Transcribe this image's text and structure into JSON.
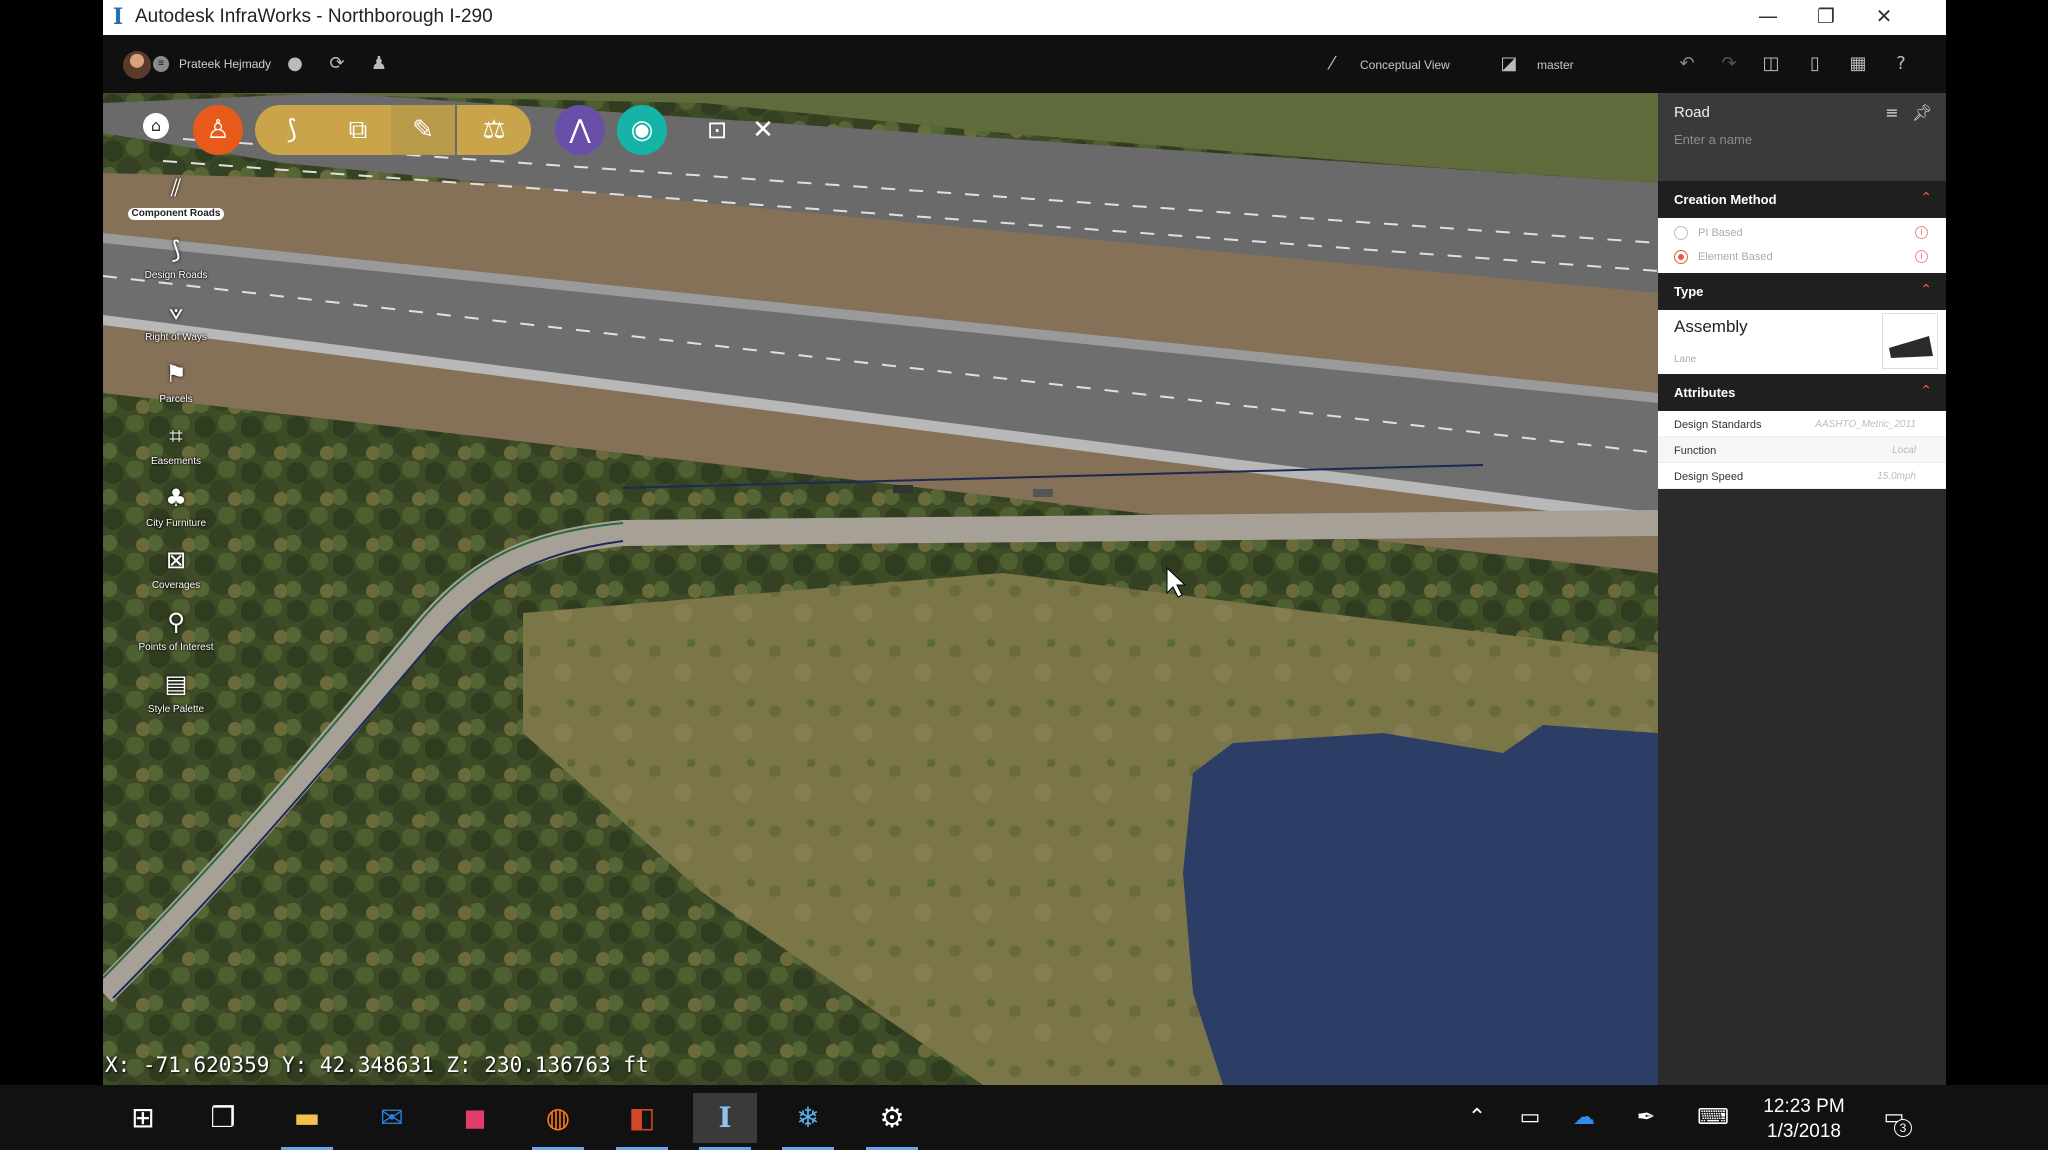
{
  "window": {
    "title": "Autodesk InfraWorks - Northborough I-290",
    "app_icon": "I",
    "controls": [
      "—",
      "❐",
      "✕"
    ]
  },
  "appbar": {
    "user_name": "Prateek Hejmady",
    "view_label": "Conceptual View",
    "branch_label": "master"
  },
  "toolbar": {
    "icons": [
      "home-icon",
      "person-icon",
      "roads-icon",
      "copy-icon",
      "pencil-icon",
      "scale-icon",
      "analyze-icon",
      "target-icon",
      "presentation-icon",
      "tools-icon"
    ]
  },
  "sidebar": {
    "items": [
      {
        "label": "Component Roads",
        "icon": "component-roads-icon",
        "active": true
      },
      {
        "label": "Design Roads",
        "icon": "design-roads-icon"
      },
      {
        "label": "Right of Ways",
        "icon": "right-of-ways-icon"
      },
      {
        "label": "Parcels",
        "icon": "parcels-icon"
      },
      {
        "label": "Easements",
        "icon": "easements-icon"
      },
      {
        "label": "City Furniture",
        "icon": "city-furniture-icon"
      },
      {
        "label": "Coverages",
        "icon": "coverages-icon"
      },
      {
        "label": "Points of Interest",
        "icon": "points-of-interest-icon"
      },
      {
        "label": "Style Palette",
        "icon": "style-palette-icon"
      }
    ]
  },
  "viewport": {
    "coordinates": "X: -71.620359 Y: 42.348631 Z: 230.136763 ft"
  },
  "panel": {
    "title": "Road",
    "name_placeholder": "Enter a name",
    "creation_method": {
      "title": "Creation Method",
      "options": [
        {
          "label": "PI Based",
          "selected": false
        },
        {
          "label": "Element Based",
          "selected": true
        }
      ]
    },
    "type": {
      "title": "Type",
      "value": "Assembly",
      "subvalue": "Lane"
    },
    "attributes": {
      "title": "Attributes",
      "rows": [
        {
          "key": "Design Standards",
          "value": "AASHTO_Metric_2011"
        },
        {
          "key": "Function",
          "value": "Local"
        },
        {
          "key": "Design Speed",
          "value": "15.0mph"
        }
      ]
    }
  },
  "taskbar": {
    "time": "12:23 PM",
    "date": "1/3/2018",
    "notification_count": "3"
  },
  "colors": {
    "accent": "#e85a3a",
    "panel_bg": "#2b2b2b",
    "toolbar_gold": "#c9a44a",
    "toolbar_purple": "#6a4fa8",
    "toolbar_teal": "#16b3a8"
  }
}
